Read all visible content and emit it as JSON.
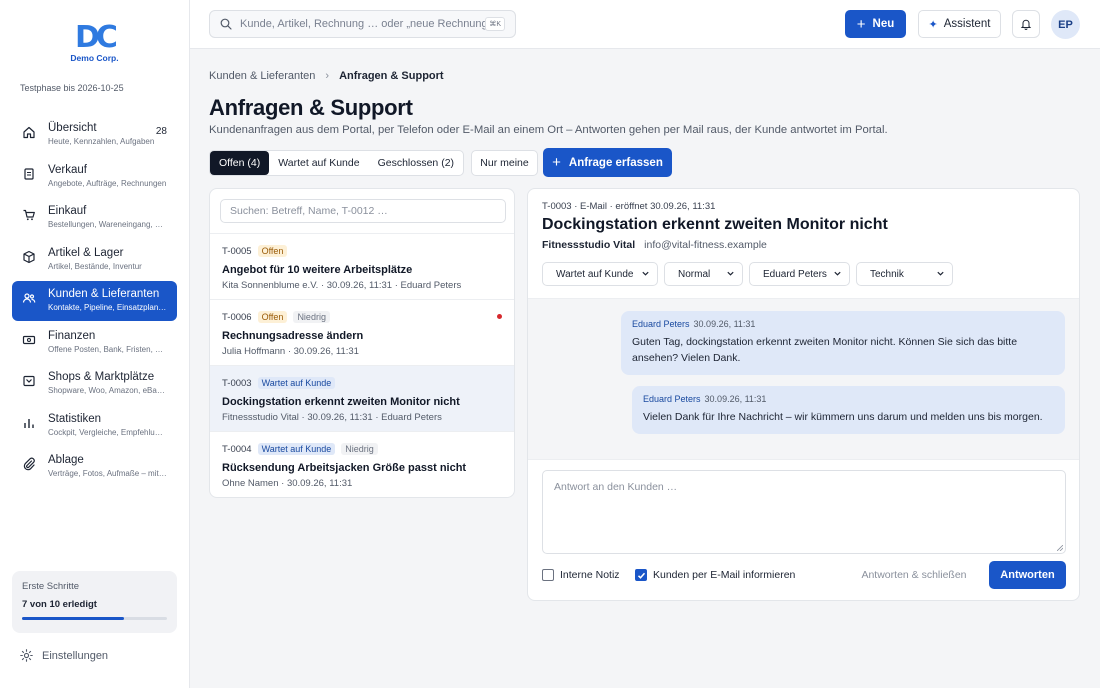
{
  "brand": {
    "logo_text": "DC",
    "company": "Demo Corp.",
    "trial": "Testphase bis 2026-10-25"
  },
  "sidebar": {
    "items": [
      {
        "title": "Übersicht",
        "sub": "Heute, Kennzahlen, Aufgaben",
        "badge": "28",
        "icon": "home-icon"
      },
      {
        "title": "Verkauf",
        "sub": "Angebote, Aufträge, Rechnungen",
        "icon": "receipt-icon"
      },
      {
        "title": "Einkauf",
        "sub": "Bestellungen, Wareneingang, Belege",
        "icon": "cart-icon"
      },
      {
        "title": "Artikel & Lager",
        "sub": "Artikel, Bestände, Inventur",
        "icon": "box-icon"
      },
      {
        "title": "Kunden & Lieferanten",
        "sub": "Kontakte, Pipeline, Einsatzplanung",
        "icon": "users-icon"
      },
      {
        "title": "Finanzen",
        "sub": "Offene Posten, Bank, Fristen, Lohn",
        "icon": "money-icon"
      },
      {
        "title": "Shops & Marktplätze",
        "sub": "Shopware, Woo, Amazon, eBay, Etsy",
        "icon": "shop-icon"
      },
      {
        "title": "Statistiken",
        "sub": "Cockpit, Vergleiche, Empfehlungen",
        "icon": "chart-icon"
      },
      {
        "title": "Ablage",
        "sub": "Verträge, Fotos, Aufmaße – mit Suche",
        "icon": "paperclip-icon"
      }
    ],
    "first_steps": {
      "title": "Erste Schritte",
      "progress_label": "7 von 10 erledigt",
      "progress": 0.7
    },
    "settings_label": "Einstellungen"
  },
  "topbar": {
    "search_placeholder": "Kunde, Artikel, Rechnung … oder „neue Rechnung“",
    "shortcut": "⌘K",
    "new_label": "Neu",
    "assistant_label": "Assistent",
    "avatar_initials": "EP"
  },
  "breadcrumb": {
    "parent": "Kunden & Lieferanten",
    "sep": "›",
    "current": "Anfragen & Support"
  },
  "page": {
    "title": "Anfragen & Support",
    "description": "Kundenanfragen aus dem Portal, per Telefon oder E-Mail an einem Ort – Antworten gehen per Mail raus, der Kunde antwortet im Portal."
  },
  "filters": {
    "tabs": [
      "Offen (4)",
      "Wartet auf Kunde",
      "Geschlossen (2)"
    ],
    "mine_label": "Nur meine",
    "create_label": "Anfrage erfassen"
  },
  "list": {
    "search_placeholder": "Suchen: Betreff, Name, T-0012 …",
    "rows": [
      {
        "id": "T-0005",
        "badges": [
          {
            "text": "Offen",
            "kind": "open"
          }
        ],
        "title": "Angebot für 10 weitere Arbeitsplätze",
        "meta": "Kita Sonnenblume e.V. · 30.09.26, 11:31 · Eduard Peters",
        "unread": false
      },
      {
        "id": "T-0006",
        "badges": [
          {
            "text": "Offen",
            "kind": "open"
          },
          {
            "text": "Niedrig",
            "kind": "low"
          }
        ],
        "title": "Rechnungsadresse ändern",
        "meta": "Julia Hoffmann · 30.09.26, 11:31",
        "unread": true
      },
      {
        "id": "T-0003",
        "badges": [
          {
            "text": "Wartet auf Kunde",
            "kind": "wait"
          }
        ],
        "title": "Dockingstation erkennt zweiten Monitor nicht",
        "meta": "Fitnessstudio Vital · 30.09.26, 11:31 · Eduard Peters",
        "unread": false
      },
      {
        "id": "T-0004",
        "badges": [
          {
            "text": "Wartet auf Kunde",
            "kind": "wait"
          },
          {
            "text": "Niedrig",
            "kind": "low"
          }
        ],
        "title": "Rücksendung Arbeitsjacken Größe passt nicht",
        "meta": "Ohne Namen · 30.09.26, 11:31",
        "unread": false
      }
    ]
  },
  "detail": {
    "header": "T-0003 · E-Mail · eröffnet 30.09.26, 11:31",
    "title": "Dockingstation erkennt zweiten Monitor nicht",
    "customer_name": "Fitnessstudio Vital",
    "customer_email": "info@vital-fitness.example",
    "selects": [
      "Wartet auf Kunde",
      "Normal",
      "Eduard Peters",
      "Technik"
    ],
    "messages": [
      {
        "author": "Eduard Peters",
        "time": "30.09.26, 11:31",
        "line1": "Guten Tag, dockingstation erkennt zweiten Monitor nicht. Können Sie sich das bitte",
        "line2": "ansehen? Vielen Dank."
      },
      {
        "author": "Eduard Peters",
        "time": "30.09.26, 11:31",
        "line1": "Vielen Dank für Ihre Nachricht – wir kümmern uns darum und melden uns bis morgen.",
        "line2": ""
      }
    ],
    "reply_placeholder": "Antwort an den Kunden …",
    "internal_note_label": "Interne Notiz",
    "notify_label": "Kunden per E-Mail informieren",
    "notify_checked": true,
    "close_label": "Antworten & schließen",
    "answer_label": "Antworten"
  }
}
